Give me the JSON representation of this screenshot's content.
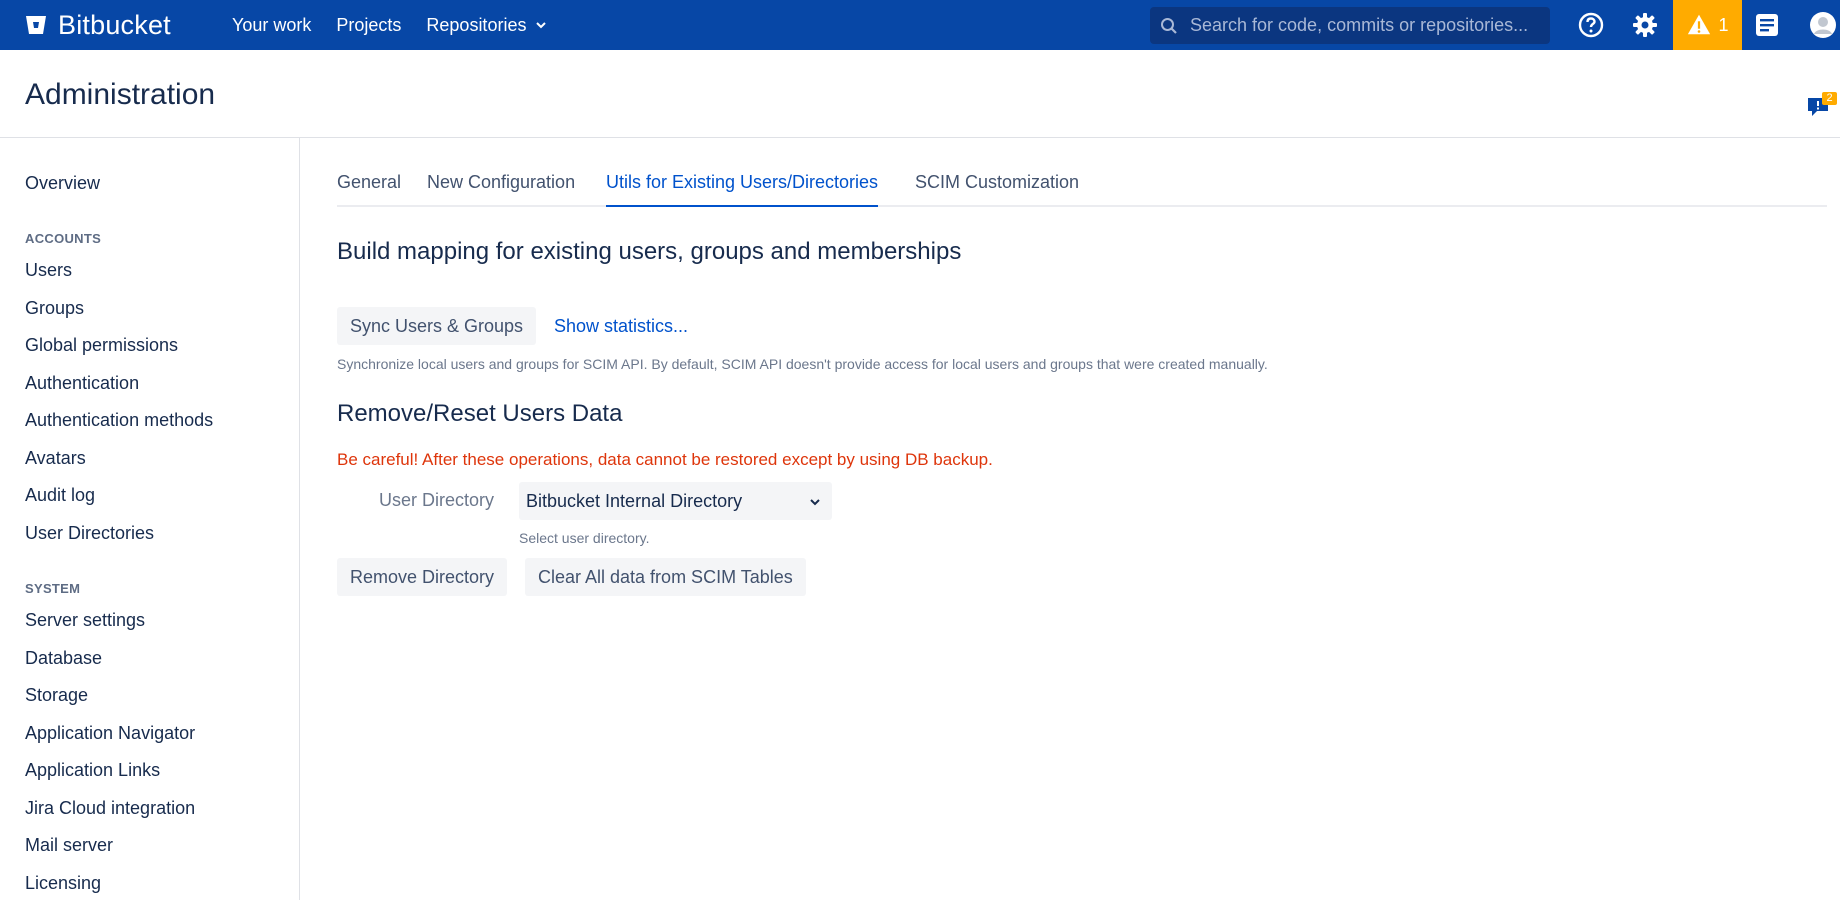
{
  "app": {
    "name": "Bitbucket"
  },
  "topnav": {
    "links": [
      {
        "label": "Your work"
      },
      {
        "label": "Projects"
      },
      {
        "label": "Repositories"
      }
    ],
    "search_placeholder": "Search for code, commits or repositories...",
    "alert_count": "1"
  },
  "header": {
    "title": "Administration",
    "feedback_badge": "2"
  },
  "sidebar": {
    "overview": "Overview",
    "accounts_heading": "ACCOUNTS",
    "accounts": [
      "Users",
      "Groups",
      "Global permissions",
      "Authentication",
      "Authentication methods",
      "Avatars",
      "Audit log",
      "User Directories"
    ],
    "system_heading": "SYSTEM",
    "system": [
      "Server settings",
      "Database",
      "Storage",
      "Application Navigator",
      "Application Links",
      "Jira Cloud integration",
      "Mail server",
      "Licensing"
    ]
  },
  "tabs": [
    {
      "label": "General"
    },
    {
      "label": "New Configuration"
    },
    {
      "label": "Utils for Existing Users/Directories"
    },
    {
      "label": "SCIM Customization"
    }
  ],
  "mapping": {
    "heading": "Build mapping for existing users, groups and memberships",
    "sync_button": "Sync Users & Groups",
    "stats_link": "Show statistics...",
    "description": "Synchronize local users and groups for SCIM API. By default, SCIM API doesn't provide access for local users and groups that were created manually."
  },
  "reset": {
    "heading": "Remove/Reset Users Data",
    "warning": "Be careful! After these operations, data cannot be restored except by using DB backup.",
    "directory_label": "User Directory",
    "directory_value": "Bitbucket Internal Directory",
    "directory_hint": "Select user directory.",
    "remove_button": "Remove Directory",
    "clear_button": "Clear All data from SCIM Tables"
  },
  "colors": {
    "topbar": "#0747a6",
    "accent": "#0052cc",
    "warning": "#de350b",
    "alert": "#ffab00"
  }
}
